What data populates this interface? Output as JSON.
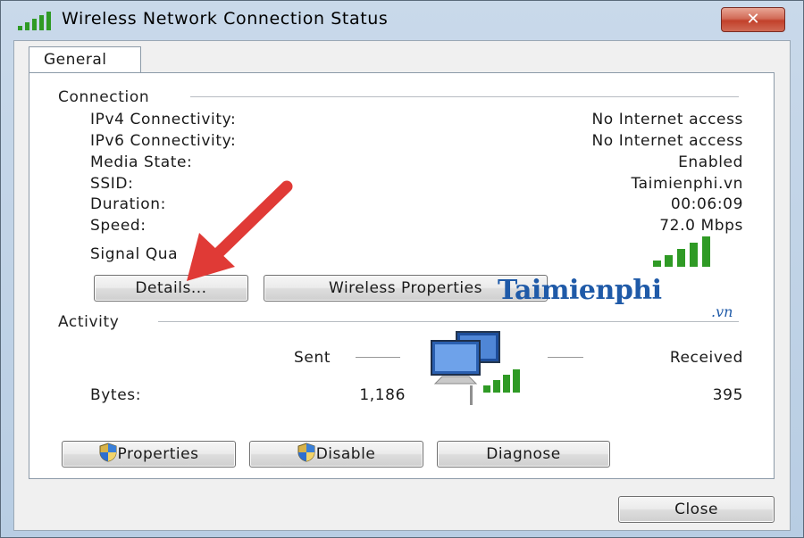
{
  "window": {
    "title": "Wireless Network Connection Status",
    "close_glyph": "✕"
  },
  "tabs": [
    {
      "label": "General",
      "active": true
    }
  ],
  "connection": {
    "heading": "Connection",
    "rows": [
      {
        "label": "IPv4 Connectivity:",
        "value": "No Internet access"
      },
      {
        "label": "IPv6 Connectivity:",
        "value": "No Internet access"
      },
      {
        "label": "Media State:",
        "value": "Enabled"
      },
      {
        "label": "SSID:",
        "value": "Taimienphi.vn"
      },
      {
        "label": "Duration:",
        "value": "00:06:09"
      },
      {
        "label": "Speed:",
        "value": "72.0 Mbps"
      }
    ],
    "signal_label": "Signal Qua",
    "signal_bars": 5,
    "details_button": "Details...",
    "wireless_properties_button": "Wireless Properties"
  },
  "activity": {
    "heading": "Activity",
    "sent_label": "Sent",
    "received_label": "Received",
    "bytes_label": "Bytes:",
    "bytes_sent": "1,186",
    "bytes_received": "395"
  },
  "buttons": {
    "properties": "Properties",
    "disable": "Disable",
    "diagnose": "Diagnose",
    "close": "Close"
  },
  "watermark": {
    "name": "Taimienphi",
    "suffix": ".vn"
  },
  "colors": {
    "signal_green": "#2f9a25",
    "arrow_red": "#e03a36",
    "watermark_blue": "#1f5aa8"
  },
  "icons": {
    "title": "signal-bars-icon",
    "shield": "uac-shield-icon",
    "network": "network-computers-icon",
    "annotation": "red-arrow-icon"
  }
}
